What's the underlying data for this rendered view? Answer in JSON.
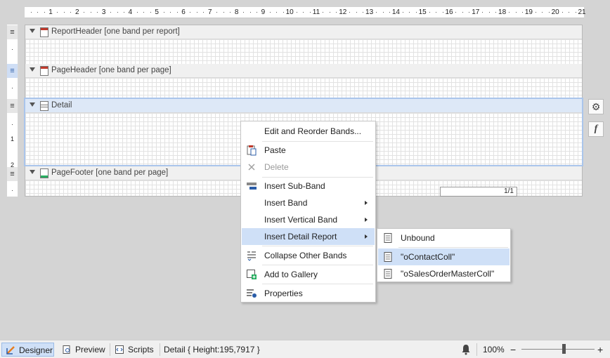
{
  "ruler": {
    "ticks": [
      "1",
      "2",
      "3",
      "4",
      "5",
      "6",
      "7",
      "8",
      "9",
      "10",
      "11",
      "12",
      "13",
      "14",
      "15",
      "16",
      "17",
      "18",
      "19",
      "20",
      "21"
    ]
  },
  "gutter": {
    "handle_glyph": "≡",
    "labels": [
      "·",
      "·",
      "1",
      "·",
      "2",
      "·"
    ]
  },
  "bands": {
    "report_header": "ReportHeader [one band per report]",
    "page_header": "PageHeader [one band per page]",
    "detail": "Detail",
    "page_footer": "PageFooter [one band per page]"
  },
  "page_number": "1/1",
  "side_buttons": {
    "gear": "⚙",
    "function": "f"
  },
  "context_menu": {
    "items": [
      {
        "label": "Edit and Reorder Bands...",
        "icon": "none"
      },
      {
        "label": "Paste",
        "icon": "paste-icon"
      },
      {
        "label": "Delete",
        "icon": "delete-icon",
        "disabled": true
      },
      {
        "label": "Insert Sub-Band",
        "icon": "sub-band-icon"
      },
      {
        "label": "Insert Band",
        "icon": "none",
        "submenu": true
      },
      {
        "label": "Insert Vertical Band",
        "icon": "none",
        "submenu": true
      },
      {
        "label": "Insert Detail Report",
        "icon": "none",
        "submenu": true,
        "highlighted": true
      },
      {
        "label": "Collapse Other Bands",
        "icon": "collapse-icon"
      },
      {
        "label": "Add to Gallery",
        "icon": "gallery-icon"
      },
      {
        "label": "Properties",
        "icon": "properties-icon"
      }
    ]
  },
  "submenu": {
    "items": [
      {
        "label": "Unbound"
      },
      {
        "label": "\"oContactColl\"",
        "highlighted": true
      },
      {
        "label": "\"oSalesOrderMasterColl\""
      }
    ]
  },
  "statusbar": {
    "designer": "Designer",
    "preview": "Preview",
    "scripts": "Scripts",
    "info": "Detail { Height:195,7917 }",
    "zoom": "100%",
    "zoom_minus": "−",
    "zoom_plus": "+",
    "zoom_level": 0.58
  },
  "colors": {
    "accent": "#2b5da8",
    "highlight": "#cfe0f7",
    "band_header": "#f0f0f0"
  }
}
